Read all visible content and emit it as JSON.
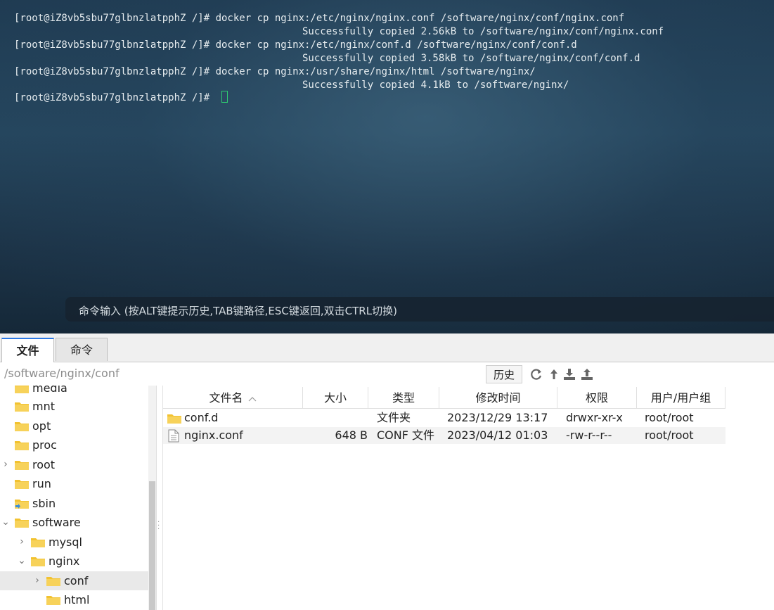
{
  "terminal": {
    "lines": [
      "[root@iZ8vb5sbu77glbnzlatpphZ /]# docker cp nginx:/etc/nginx/nginx.conf /software/nginx/conf/nginx.conf",
      "Successfully copied 2.56kB to /software/nginx/conf/nginx.conf",
      "[root@iZ8vb5sbu77glbnzlatpphZ /]# docker cp nginx:/etc/nginx/conf.d /software/nginx/conf/conf.d",
      "Successfully copied 3.58kB to /software/nginx/conf/conf.d",
      "[root@iZ8vb5sbu77glbnzlatpphZ /]# docker cp nginx:/usr/share/nginx/html /software/nginx/",
      "Successfully copied 4.1kB to /software/nginx/",
      "[root@iZ8vb5sbu77glbnzlatpphZ /]# "
    ],
    "command_input_placeholder": "命令输入 (按ALT键提示历史,TAB键路径,ESC键返回,双击CTRL切换)",
    "cursor_color": "#2ecc71"
  },
  "tabs": [
    {
      "label": "文件",
      "active": true
    },
    {
      "label": "命令",
      "active": false
    }
  ],
  "pathbar": {
    "path": "/software/nginx/conf",
    "history_label": "历史",
    "icons": [
      "refresh-icon",
      "up-arrow-icon",
      "download-icon",
      "upload-icon"
    ]
  },
  "tree": {
    "items": [
      {
        "label": "media",
        "expander": "none"
      },
      {
        "label": "mnt",
        "expander": "none"
      },
      {
        "label": "opt",
        "expander": "none"
      },
      {
        "label": "proc",
        "expander": "none"
      },
      {
        "label": "root",
        "expander": "collapsed"
      },
      {
        "label": "run",
        "expander": "none"
      },
      {
        "label": "sbin",
        "expander": "none"
      },
      {
        "label": "software",
        "expander": "expanded"
      },
      {
        "label": "mysql",
        "expander": "collapsed"
      },
      {
        "label": "nginx",
        "expander": "expanded"
      },
      {
        "label": "conf",
        "expander": "collapsed",
        "selected": true
      },
      {
        "label": "html",
        "expander": "none"
      }
    ]
  },
  "table": {
    "headers": [
      "文件名",
      "大小",
      "类型",
      "修改时间",
      "权限",
      "用户/用户组"
    ],
    "sort_indicator": "^",
    "rows": [
      {
        "icon": "folder-icon",
        "name": "conf.d",
        "size": "",
        "type": "文件夹",
        "modified": "2023/12/29 13:17",
        "perms": "drwxr-xr-x",
        "owner": "root/root"
      },
      {
        "icon": "file-icon",
        "name": "nginx.conf",
        "size": "648 B",
        "type": "CONF 文件",
        "modified": "2023/04/12 01:03",
        "perms": "-rw-r--r--",
        "owner": "root/root"
      }
    ]
  },
  "colors": {
    "folder": "#f2c230",
    "tab_accent": "#2b78e4",
    "selection": "#e9e9e9"
  }
}
